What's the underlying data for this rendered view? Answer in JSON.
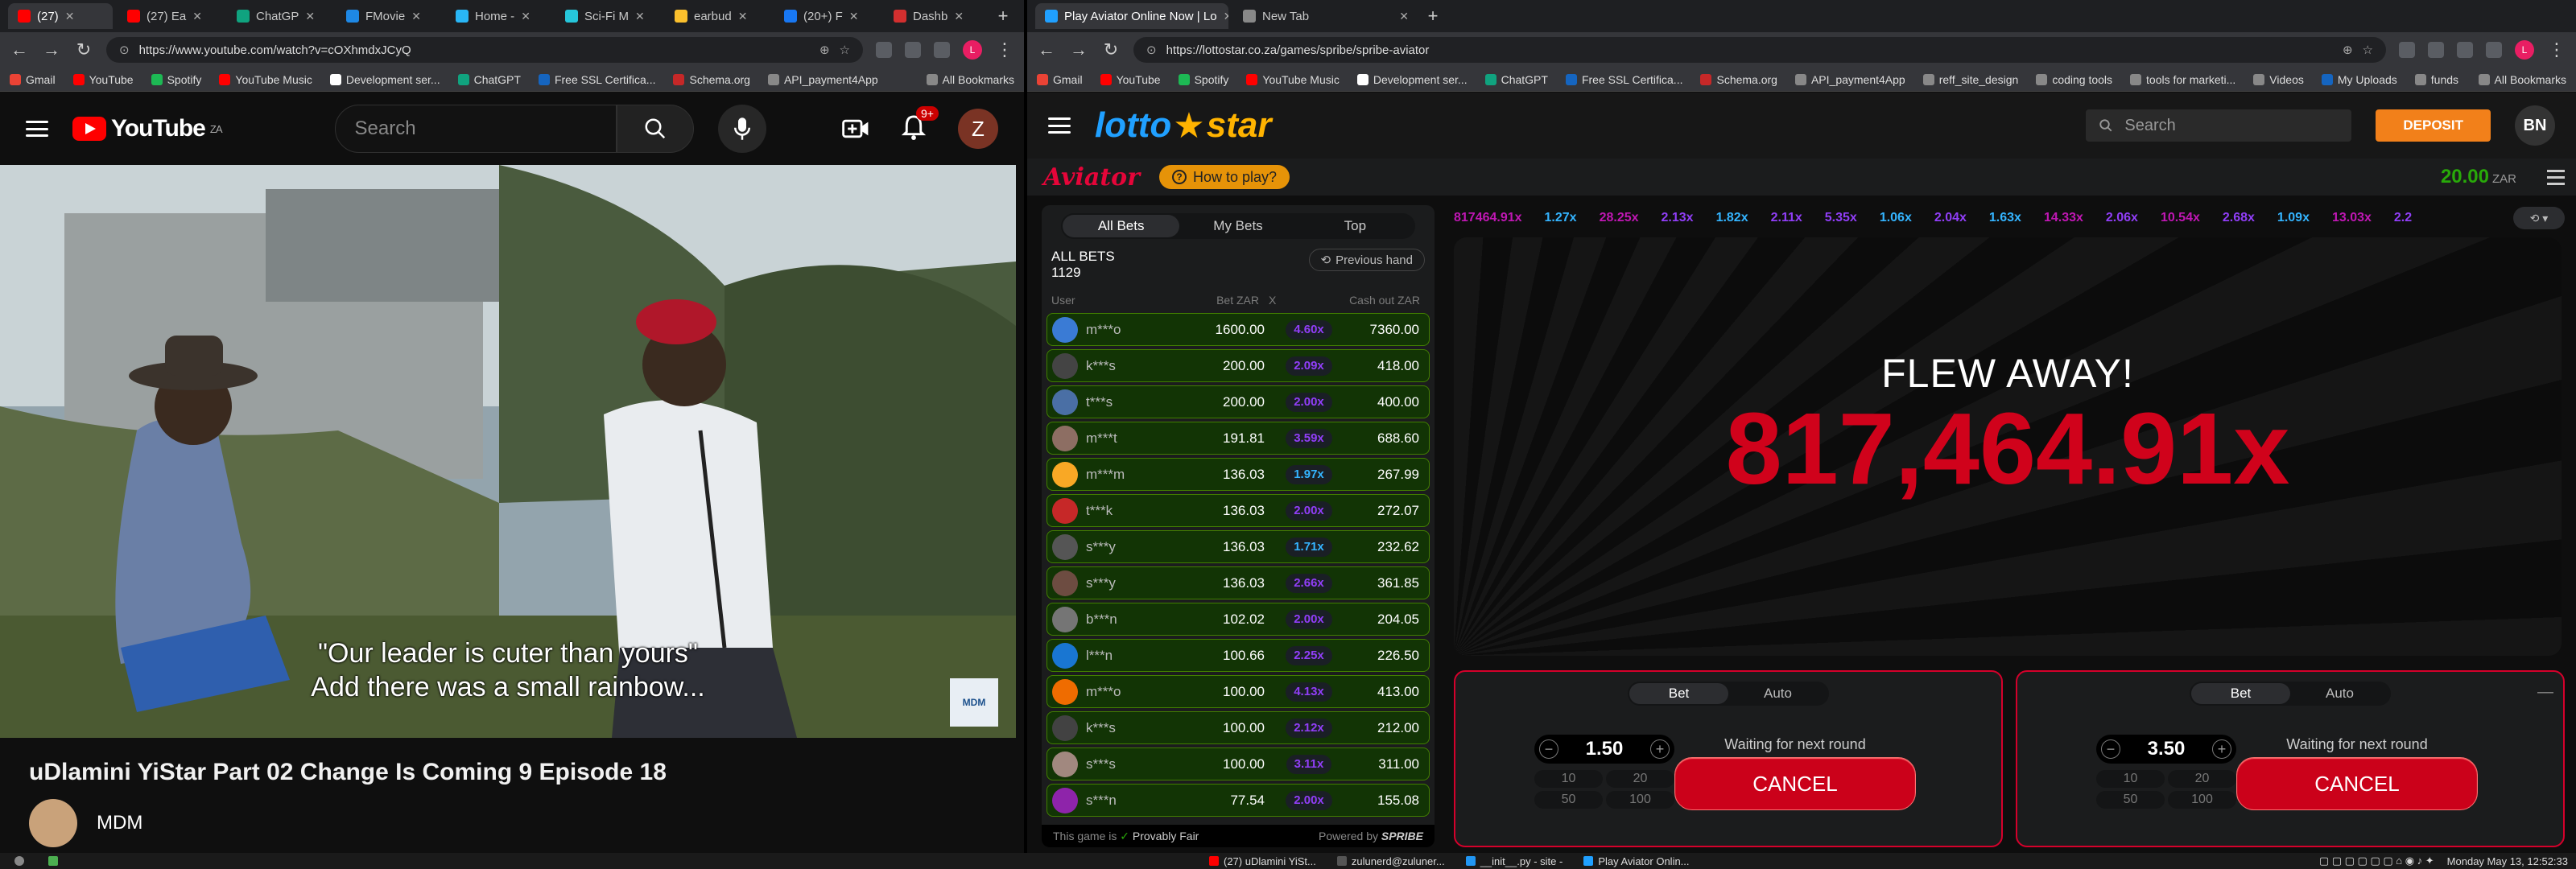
{
  "left_browser": {
    "tabs": [
      {
        "label": "(27)",
        "color": "#ff0000"
      },
      {
        "label": "(27) Ea",
        "color": "#ff0000"
      },
      {
        "label": "ChatGP",
        "color": "#10a37f"
      },
      {
        "label": "FMovie",
        "color": "#1e88e5"
      },
      {
        "label": "Home -",
        "color": "#29b6f6"
      },
      {
        "label": "Sci-Fi M",
        "color": "#26c6da"
      },
      {
        "label": "earbud",
        "color": "#fbc02d"
      },
      {
        "label": "(20+) F",
        "color": "#1877f2"
      },
      {
        "label": "Dashb",
        "color": "#d32f2f"
      }
    ],
    "url": "https://www.youtube.com/watch?v=cOXhmdxJCyQ",
    "bookmarks": [
      {
        "label": "Gmail",
        "color": "#ea4335"
      },
      {
        "label": "YouTube",
        "color": "#ff0000"
      },
      {
        "label": "Spotify",
        "color": "#1db954"
      },
      {
        "label": "YouTube Music",
        "color": "#ff0000"
      },
      {
        "label": "Development ser...",
        "color": "#ffffff"
      },
      {
        "label": "ChatGPT",
        "color": "#10a37f"
      },
      {
        "label": "Free SSL Certifica...",
        "color": "#1565c0"
      },
      {
        "label": "Schema.org",
        "color": "#c62828"
      },
      {
        "label": "API_payment4App",
        "color": "#888888"
      }
    ],
    "all_bookmarks": "All Bookmarks"
  },
  "youtube": {
    "logo_text": "YouTube",
    "region": "ZA",
    "search_placeholder": "Search",
    "notifications_badge": "9+",
    "avatar_letter": "Z",
    "caption_line1": "\"Our leader is cuter than yours\"",
    "caption_line2": "Add there was a small rainbow...",
    "watermark": "MDM",
    "video_title": "uDlamini YiStar Part 02 Change Is Coming 9 Episode 18",
    "channel": "MDM"
  },
  "right_browser": {
    "tabs": [
      {
        "label": "Play Aviator Online Now | Lo",
        "color": "#20a0ff",
        "active": true
      },
      {
        "label": "New Tab",
        "color": "#888888",
        "active": false
      }
    ],
    "url": "https://lottostar.co.za/games/spribe/spribe-aviator",
    "bookmarks": [
      {
        "label": "Gmail",
        "color": "#ea4335"
      },
      {
        "label": "YouTube",
        "color": "#ff0000"
      },
      {
        "label": "Spotify",
        "color": "#1db954"
      },
      {
        "label": "YouTube Music",
        "color": "#ff0000"
      },
      {
        "label": "Development ser...",
        "color": "#ffffff"
      },
      {
        "label": "ChatGPT",
        "color": "#10a37f"
      },
      {
        "label": "Free SSL Certifica...",
        "color": "#1565c0"
      },
      {
        "label": "Schema.org",
        "color": "#c62828"
      },
      {
        "label": "API_payment4App",
        "color": "#888888"
      },
      {
        "label": "reff_site_design",
        "color": "#888888"
      },
      {
        "label": "coding tools",
        "color": "#888888"
      },
      {
        "label": "tools for marketi...",
        "color": "#888888"
      },
      {
        "label": "Videos",
        "color": "#888888"
      },
      {
        "label": "My Uploads",
        "color": "#1565c0"
      },
      {
        "label": "funds",
        "color": "#888888"
      }
    ],
    "all_bookmarks": "All Bookmarks"
  },
  "lottostar": {
    "logo_a": "lotto",
    "logo_b": "star",
    "search_placeholder": "Search",
    "deposit": "DEPOSIT",
    "avatar": "BN"
  },
  "aviator": {
    "logo": "Aviator",
    "how_to": "How to play?",
    "balance": "20.00",
    "currency": "ZAR",
    "bets_tabs": [
      "All Bets",
      "My Bets",
      "Top"
    ],
    "all_bets_label": "ALL BETS",
    "all_bets_count": "1129",
    "previous_hand": "Previous hand",
    "col_user": "User",
    "col_bet": "Bet ZAR",
    "col_x": "X",
    "col_cashout": "Cash out ZAR",
    "bets": [
      {
        "user": "m***o",
        "bet": "1600.00",
        "x": "4.60x",
        "cashout": "7360.00",
        "xcolor": "#913ef8",
        "avatar": "#3a7bd5"
      },
      {
        "user": "k***s",
        "bet": "200.00",
        "x": "2.09x",
        "cashout": "418.00",
        "xcolor": "#913ef8",
        "avatar": "#444444"
      },
      {
        "user": "t***s",
        "bet": "200.00",
        "x": "2.00x",
        "cashout": "400.00",
        "xcolor": "#913ef8",
        "avatar": "#4a6fa5"
      },
      {
        "user": "m***t",
        "bet": "191.81",
        "x": "3.59x",
        "cashout": "688.60",
        "xcolor": "#913ef8",
        "avatar": "#8d6e63"
      },
      {
        "user": "m***m",
        "bet": "136.03",
        "x": "1.97x",
        "cashout": "267.99",
        "xcolor": "#34b4ff",
        "avatar": "#f9a825"
      },
      {
        "user": "t***k",
        "bet": "136.03",
        "x": "2.00x",
        "cashout": "272.07",
        "xcolor": "#913ef8",
        "avatar": "#c62828"
      },
      {
        "user": "s***y",
        "bet": "136.03",
        "x": "1.71x",
        "cashout": "232.62",
        "xcolor": "#34b4ff",
        "avatar": "#555555"
      },
      {
        "user": "s***y",
        "bet": "136.03",
        "x": "2.66x",
        "cashout": "361.85",
        "xcolor": "#913ef8",
        "avatar": "#6d4c41"
      },
      {
        "user": "b***n",
        "bet": "102.02",
        "x": "2.00x",
        "cashout": "204.05",
        "xcolor": "#913ef8",
        "avatar": "#757575"
      },
      {
        "user": "l***n",
        "bet": "100.66",
        "x": "2.25x",
        "cashout": "226.50",
        "xcolor": "#913ef8",
        "avatar": "#1976d2"
      },
      {
        "user": "m***o",
        "bet": "100.00",
        "x": "4.13x",
        "cashout": "413.00",
        "xcolor": "#913ef8",
        "avatar": "#ef6c00"
      },
      {
        "user": "k***s",
        "bet": "100.00",
        "x": "2.12x",
        "cashout": "212.00",
        "xcolor": "#913ef8",
        "avatar": "#424242"
      },
      {
        "user": "s***s",
        "bet": "100.00",
        "x": "3.11x",
        "cashout": "311.00",
        "xcolor": "#913ef8",
        "avatar": "#a1887f"
      },
      {
        "user": "s***n",
        "bet": "77.54",
        "x": "2.00x",
        "cashout": "155.08",
        "xcolor": "#913ef8",
        "avatar": "#8e24aa"
      }
    ],
    "provably_fair": "This game is",
    "provably_fair_b": "Provably Fair",
    "powered_by": "Powered by",
    "powered_brand": "SPRIBE",
    "multipliers": [
      {
        "v": "817464.91x",
        "c": "#c017b4"
      },
      {
        "v": "1.27x",
        "c": "#34b4ff"
      },
      {
        "v": "28.25x",
        "c": "#c017b4"
      },
      {
        "v": "2.13x",
        "c": "#913ef8"
      },
      {
        "v": "1.82x",
        "c": "#34b4ff"
      },
      {
        "v": "2.11x",
        "c": "#913ef8"
      },
      {
        "v": "5.35x",
        "c": "#913ef8"
      },
      {
        "v": "1.06x",
        "c": "#34b4ff"
      },
      {
        "v": "2.04x",
        "c": "#913ef8"
      },
      {
        "v": "1.63x",
        "c": "#34b4ff"
      },
      {
        "v": "14.33x",
        "c": "#c017b4"
      },
      {
        "v": "2.06x",
        "c": "#913ef8"
      },
      {
        "v": "10.54x",
        "c": "#c017b4"
      },
      {
        "v": "2.68x",
        "c": "#913ef8"
      },
      {
        "v": "1.09x",
        "c": "#34b4ff"
      },
      {
        "v": "13.03x",
        "c": "#c017b4"
      },
      {
        "v": "2.2",
        "c": "#913ef8"
      }
    ],
    "flew_away": "FLEW AWAY!",
    "big_multiplier": "817,464.91x",
    "panels": [
      {
        "tab_bet": "Bet",
        "tab_auto": "Auto",
        "stake": "1.50",
        "quick": [
          "10",
          "20",
          "50",
          "100"
        ],
        "waiting": "Waiting for next round",
        "cancel": "CANCEL"
      },
      {
        "tab_bet": "Bet",
        "tab_auto": "Auto",
        "stake": "3.50",
        "quick": [
          "10",
          "20",
          "50",
          "100"
        ],
        "waiting": "Waiting for next round",
        "cancel": "CANCEL"
      }
    ]
  },
  "taskbar": {
    "items": [
      "(27) uDlamini YiSt...",
      "zulunerd@zuluner...",
      "__init__.py - site -",
      "Play Aviator Onlin..."
    ],
    "clock": "Monday May 13, 12:52:33"
  }
}
